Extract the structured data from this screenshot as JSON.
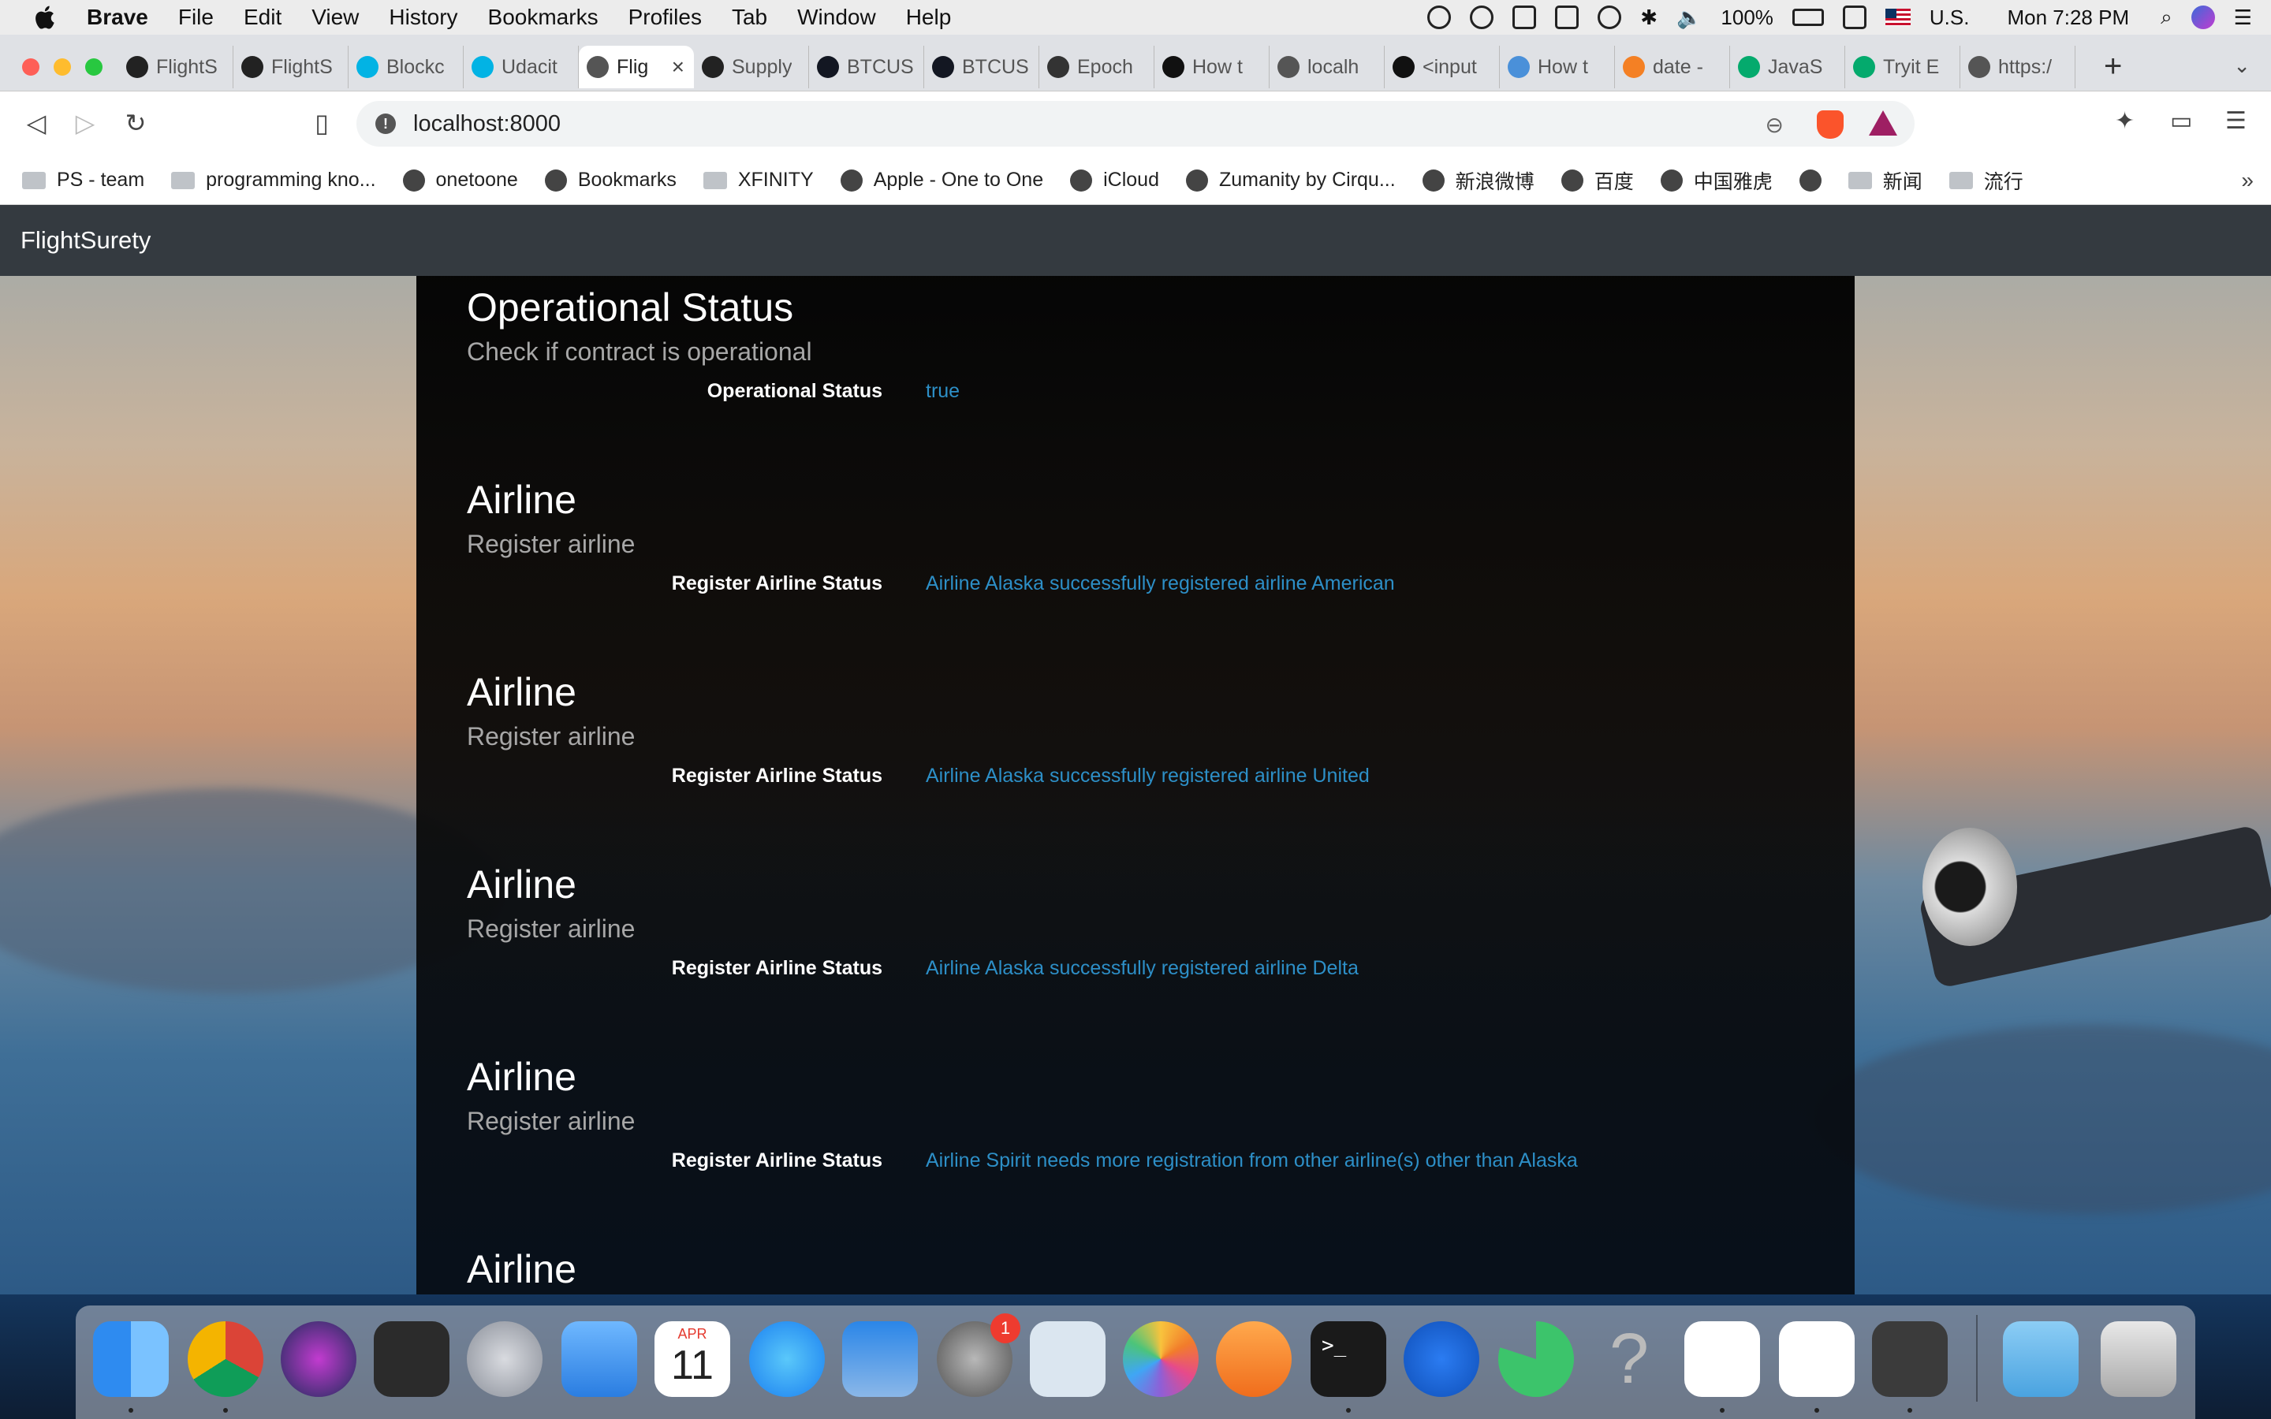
{
  "menubar": {
    "app_name": "Brave",
    "items": [
      "File",
      "Edit",
      "View",
      "History",
      "Bookmarks",
      "Profiles",
      "Tab",
      "Window",
      "Help"
    ],
    "battery": "100%",
    "input_source": "U.S.",
    "clock": "Mon 7:28 PM"
  },
  "tabs": [
    {
      "title": "FlightS",
      "icon": "github-icon"
    },
    {
      "title": "FlightS",
      "icon": "github-icon"
    },
    {
      "title": "Blockc",
      "icon": "udacity-icon"
    },
    {
      "title": "Udacit",
      "icon": "udacity-icon"
    },
    {
      "title": "Flig",
      "icon": "globe-icon",
      "active": true
    },
    {
      "title": "Supply",
      "icon": "github-icon"
    },
    {
      "title": "BTCUS",
      "icon": "tradingview-icon"
    },
    {
      "title": "BTCUS",
      "icon": "tradingview-icon"
    },
    {
      "title": "Epoch",
      "icon": "clock-icon"
    },
    {
      "title": "How t",
      "icon": "hexagon-icon"
    },
    {
      "title": "localh",
      "icon": "globe-icon"
    },
    {
      "title": "<input",
      "icon": "mdn-icon"
    },
    {
      "title": "How t",
      "icon": "code-icon"
    },
    {
      "title": "date -",
      "icon": "stackoverflow-icon"
    },
    {
      "title": "JavaS",
      "icon": "w3schools-icon"
    },
    {
      "title": "Tryit E",
      "icon": "w3schools-icon"
    },
    {
      "title": "https:/",
      "icon": "globe-icon"
    }
  ],
  "toolbar": {
    "url": "localhost:8000"
  },
  "bookmarks": [
    {
      "label": "PS - team",
      "icon": "folder-icon"
    },
    {
      "label": "programming kno...",
      "icon": "folder-icon"
    },
    {
      "label": "onetoone",
      "icon": "globe-icon"
    },
    {
      "label": "Bookmarks",
      "icon": "bookmark-icon"
    },
    {
      "label": "XFINITY",
      "icon": "folder-icon"
    },
    {
      "label": "Apple - One to One",
      "icon": "apple-icon"
    },
    {
      "label": "iCloud",
      "icon": "apple-icon"
    },
    {
      "label": "Zumanity by Cirqu...",
      "icon": "tw-icon"
    },
    {
      "label": "新浪微博",
      "icon": "weibo-icon"
    },
    {
      "label": "百度",
      "icon": "baidu-icon"
    },
    {
      "label": "中国雅虎",
      "icon": "yahoo-icon"
    },
    {
      "label": "",
      "icon": "globe-icon"
    },
    {
      "label": "新闻",
      "icon": "folder-icon"
    },
    {
      "label": "流行",
      "icon": "folder-icon"
    }
  ],
  "app": {
    "brand": "FlightSurety",
    "sections": [
      {
        "title": "Operational Status",
        "subtitle": "Check if contract is operational",
        "label": "Operational Status",
        "value": "true"
      },
      {
        "title": "Airline",
        "subtitle": "Register airline",
        "label": "Register Airline Status",
        "value": "Airline Alaska successfully registered airline American"
      },
      {
        "title": "Airline",
        "subtitle": "Register airline",
        "label": "Register Airline Status",
        "value": "Airline Alaska successfully registered airline United"
      },
      {
        "title": "Airline",
        "subtitle": "Register airline",
        "label": "Register Airline Status",
        "value": "Airline Alaska successfully registered airline Delta"
      },
      {
        "title": "Airline",
        "subtitle": "Register airline",
        "label": "Register Airline Status",
        "value": "Airline Spirit needs more registration from other airline(s) other than Alaska"
      },
      {
        "title": "Airline"
      }
    ]
  },
  "dock": {
    "calendar_month": "APR",
    "calendar_day": "11",
    "system_prefs_badge": "1",
    "apps": [
      "finder-icon",
      "chrome-icon",
      "siri-icon",
      "activity-icon",
      "launchpad-icon",
      "mail-icon",
      "calendar-icon",
      "messages-icon",
      "keynote-icon",
      "system-preferences-icon",
      "preview-icon",
      "photos-icon",
      "books-icon",
      "terminal-icon",
      "location-icon",
      "loading-icon",
      "help-icon",
      "brave-icon",
      "vscode-icon",
      "sublime-icon",
      "downloads-folder-icon",
      "trash-icon"
    ]
  },
  "colors": {
    "navbar": "#343a40",
    "status_value": "#2d8fc7",
    "brave_orange": "#fb542b"
  }
}
